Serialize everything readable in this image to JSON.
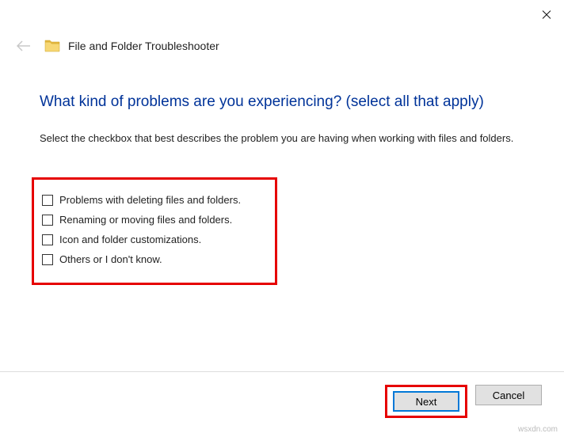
{
  "header": {
    "title": "File and Folder Troubleshooter"
  },
  "main": {
    "question": "What kind of problems are you experiencing? (select all that apply)",
    "instruction": "Select the checkbox that best describes the problem you are having when working with files and folders.",
    "options": [
      "Problems with deleting files and folders.",
      "Renaming or moving files and folders.",
      "Icon and folder customizations.",
      "Others or I don't know."
    ]
  },
  "footer": {
    "next": "Next",
    "cancel": "Cancel"
  },
  "watermark": "wsxdn.com"
}
